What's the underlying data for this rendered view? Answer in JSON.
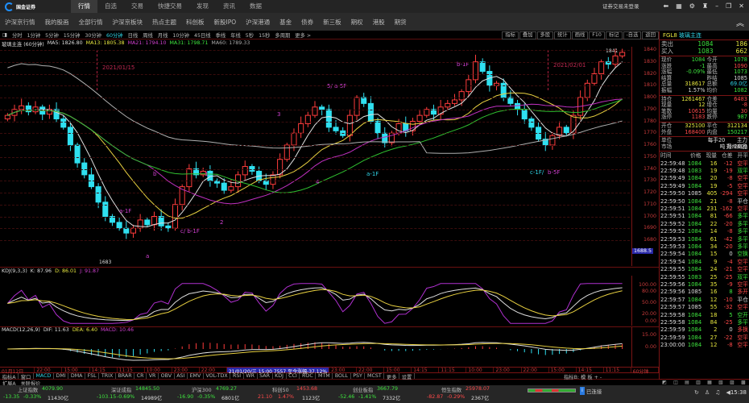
{
  "app": {
    "brand": "国金证券",
    "login": "证券交易未登录",
    "nav": [
      "行情",
      "自选",
      "交易",
      "快捷交易",
      "发现",
      "资讯",
      "数据"
    ],
    "submenu": [
      "沪深京行情",
      "我的股画",
      "全部行情",
      "沪深京板块",
      "热点主题",
      "科创板",
      "新股IPO",
      "沪深港通",
      "基金",
      "债券",
      "新三板",
      "期权",
      "港股",
      "期货"
    ]
  },
  "toolbar": {
    "periods": [
      "分时",
      "1分钟",
      "5分钟",
      "15分钟",
      "30分钟",
      "60分钟",
      "日线",
      "周线",
      "月线",
      "10分钟",
      "45日线",
      "季线",
      "年线",
      "5秒",
      "15秒",
      "多周期",
      "更多 >"
    ],
    "active": "60分钟",
    "actions": [
      "指标",
      "叠加",
      "多股",
      "统计",
      "画线",
      "F10",
      "标记",
      "-自选",
      "返回"
    ]
  },
  "ma_info": {
    "name": "玻璃主连 (60分钟)",
    "ma5": "MA5: 1826.80",
    "ma13": "MA13: 1805.38",
    "ma21": "MA21: 1794.10",
    "ma31": "MA31: 1798.71",
    "ma60": "MA60: 1789.33"
  },
  "kdj_info": {
    "name": "KDJ(9,3,3)",
    "k": "K: 87.96",
    "d": "D: 86.01",
    "j": "J: 91.87"
  },
  "macd_info": {
    "name": "MACD(12,26,9)",
    "dif": "DIF: 11.63",
    "dea": "DEA: 6.40",
    "macd": "MACD: 10.46"
  },
  "price_axis": [
    "1840",
    "1830",
    "1820",
    "1810",
    "1800",
    "1790",
    "1780",
    "1770",
    "1760",
    "1750",
    "1740",
    "1730",
    "1720",
    "1710",
    "1700",
    "1690",
    "1680"
  ],
  "kdj_axis": [
    "100.00",
    "80.00",
    "50.00",
    "20.00",
    "0.00"
  ],
  "macd_axis": [
    "15.00",
    "0.00"
  ],
  "cursor_price": "1688.5",
  "annotations": {
    "date1": "2021/01/15",
    "date2": "2021/02/01",
    "high": "1841",
    "low": "1683",
    "w1": "b-1F",
    "w2": "5/ a-5F",
    "w3": "3",
    "w4": "b",
    "w5": "1",
    "w6": "a-1F",
    "w7": "2",
    "w8": "c/ b-1F",
    "w9": "4",
    "w10": "a-1F",
    "w11": "c-1F/",
    "w12": "b-5F",
    "w13": "a"
  },
  "kline": {
    "closes": [
      1785,
      1790,
      1793,
      1788,
      1792,
      1786,
      1790,
      1782,
      1775,
      1760,
      1745,
      1735,
      1725,
      1712,
      1700,
      1695,
      1690,
      1686,
      1690,
      1697,
      1693,
      1700,
      1692,
      1690,
      1710,
      1725,
      1740,
      1735,
      1738,
      1730,
      1728,
      1722,
      1725,
      1735,
      1742,
      1738,
      1730,
      1727,
      1735,
      1748,
      1760,
      1770,
      1778,
      1785,
      1792,
      1790,
      1775,
      1772,
      1768,
      1785,
      1800,
      1795,
      1780,
      1770,
      1762,
      1770,
      1778,
      1772,
      1780,
      1785,
      1790,
      1786,
      1792,
      1795,
      1798,
      1805,
      1815,
      1830,
      1822,
      1810,
      1812,
      1800,
      1795,
      1790,
      1782,
      1775,
      1765,
      1760,
      1768,
      1775,
      1770,
      1785,
      1800,
      1812,
      1820,
      1830,
      1828,
      1835,
      1838
    ],
    "colors": {
      "up": "#ff3c3c",
      "down": "#2fe0f0",
      "ma5": "#e0e0e0",
      "ma13": "#e8d040",
      "ma21": "#c030c0",
      "ma31": "#30c030",
      "ma60": "#b0b0b0"
    }
  },
  "time_axis": [
    "01月12日",
    "22:00",
    "15:00",
    "14:15",
    "11:15",
    "10:00",
    "23:00",
    "22:00",
    "21/01/20/三 15:00 7557 至今涨幅-37.12%",
    "23:00",
    "22:00",
    "15:00",
    "14:15",
    "11:15",
    "10:00",
    "23:00",
    "22:00",
    "15:00",
    "14:15",
    "11:15",
    "60分钟"
  ],
  "indicator_tabs": [
    "指标A",
    "窗口",
    "MACD",
    "DMI",
    "DMA",
    "FSL",
    "TRIX",
    "BRAR",
    "CR",
    "VR",
    "OBV",
    "ASI",
    "EMV",
    "VOL-TDX",
    "RSI",
    "WR",
    "SAR",
    "KDJ",
    "CCI",
    "ROC",
    "MTM",
    "BOLL",
    "PSY",
    "MCST",
    "更多",
    "设置"
  ],
  "indicator_b": "指标B: 模 板  +  -",
  "ext_tabs": [
    "扩展A",
    "关联报价"
  ],
  "indices": [
    {
      "name": "上证指数",
      "value": "4079.90",
      "chg": "-13.35",
      "pct": "-0.33%",
      "amt": "11430亿",
      "dir": "down"
    },
    {
      "name": "深证成指",
      "value": "14845.50",
      "chg": "-103.15",
      "pct": "-0.69%",
      "amt": "14989亿",
      "dir": "down"
    },
    {
      "name": "沪深300",
      "value": "4769.27",
      "chg": "-16.90",
      "pct": "-0.35%",
      "amt": "6801亿",
      "dir": "down"
    },
    {
      "name": "科创50",
      "value": "1453.68",
      "chg": "21.10",
      "pct": "1.47%",
      "amt": "1123亿",
      "dir": "up"
    },
    {
      "name": "创业板指",
      "value": "3667.79",
      "chg": "-52.46",
      "pct": "-1.41%",
      "amt": "7332亿",
      "dir": "down"
    },
    {
      "name": "恒生指数",
      "value": "25978.07",
      "chg": "-82.87",
      "pct": "-0.29%",
      "amt": "2367亿",
      "dir": "up"
    }
  ],
  "status": {
    "connection": "已连接",
    "time": "15:38"
  },
  "quote": {
    "code": "FGL8",
    "name": "玻璃主连",
    "book": [
      [
        "卖出",
        "1084",
        "186"
      ],
      [
        "买入",
        "1083",
        "662"
      ]
    ],
    "rows": [
      [
        "现价",
        "1084",
        "今开",
        "1078"
      ],
      [
        "涨跌",
        "-1",
        "最高",
        "1090"
      ],
      [
        "涨幅",
        "-0.09%",
        "最低",
        "1073"
      ],
      [
        "结算",
        "",
        "昨结",
        "1085"
      ],
      [
        "总量",
        "318617",
        "总额",
        "69.0亿"
      ],
      [
        "振幅",
        "1.57%",
        "均价",
        "1082"
      ],
      [
        "持仓",
        "1261467",
        "仓差",
        "6483"
      ],
      [
        "现量",
        "12",
        "增仓",
        "-8"
      ],
      [
        "笔数",
        "10615",
        "均量",
        "30"
      ],
      [
        "涨停",
        "1183",
        "跌停",
        "987"
      ],
      [
        "开仓",
        "325100",
        "平仓",
        "312134"
      ],
      [
        "外盘",
        "168400",
        "内盘",
        "150217"
      ],
      [
        "单位",
        "",
        "每手20吨",
        "主力月:2609"
      ],
      [
        "市场",
        "",
        "",
        "郑州商品"
      ]
    ]
  },
  "trades": {
    "headers": [
      "时间",
      "价格",
      "现量",
      "仓差",
      "开平"
    ],
    "rows": [
      [
        "22:59:48",
        "1084",
        "16",
        "-12",
        "空平"
      ],
      [
        "22:59:48",
        "1083",
        "19",
        "-19",
        "双平"
      ],
      [
        "22:59:49",
        "1084",
        "20",
        "-8",
        "空平"
      ],
      [
        "22:59:49",
        "1084",
        "19",
        "-5",
        "空平"
      ],
      [
        "22:59:50",
        "1085",
        "405",
        "-294",
        "空平"
      ],
      [
        "22:59:50",
        "1084",
        "21",
        "-8",
        "平仓"
      ],
      [
        "22:59:51",
        "1084",
        "231",
        "-162",
        "空平"
      ],
      [
        "22:59:51",
        "1084",
        "81",
        "-66",
        "多平"
      ],
      [
        "22:59:52",
        "1084",
        "22",
        "-20",
        "多平"
      ],
      [
        "22:59:52",
        "1084",
        "14",
        "-8",
        "多平"
      ],
      [
        "22:59:53",
        "1084",
        "61",
        "-42",
        "多平"
      ],
      [
        "22:59:53",
        "1084",
        "34",
        "-20",
        "多平"
      ],
      [
        "22:59:54",
        "1084",
        "15",
        "0",
        "空换"
      ],
      [
        "22:59:54",
        "1084",
        "9",
        "-4",
        "空平"
      ],
      [
        "22:59:55",
        "1084",
        "24",
        "-21",
        "空平"
      ],
      [
        "22:59:55",
        "1083",
        "25",
        "-25",
        "双平"
      ],
      [
        "22:59:56",
        "1084",
        "35",
        "-9",
        "空平"
      ],
      [
        "22:59:56",
        "1085",
        "16",
        "8",
        "多开"
      ],
      [
        "22:59:57",
        "1084",
        "12",
        "-10",
        "平仓"
      ],
      [
        "22:59:57",
        "1085",
        "55",
        "-32",
        "空平"
      ],
      [
        "22:59:58",
        "1084",
        "18",
        "5",
        "空开"
      ],
      [
        "22:59:58",
        "1084",
        "84",
        "-25",
        "多平"
      ],
      [
        "22:59:59",
        "1084",
        "2",
        "0",
        "多换"
      ],
      [
        "22:59:59",
        "1084",
        "27",
        "-22",
        "空平"
      ],
      [
        "23:00:00",
        "1084",
        "12",
        "-8",
        "空平"
      ]
    ]
  }
}
